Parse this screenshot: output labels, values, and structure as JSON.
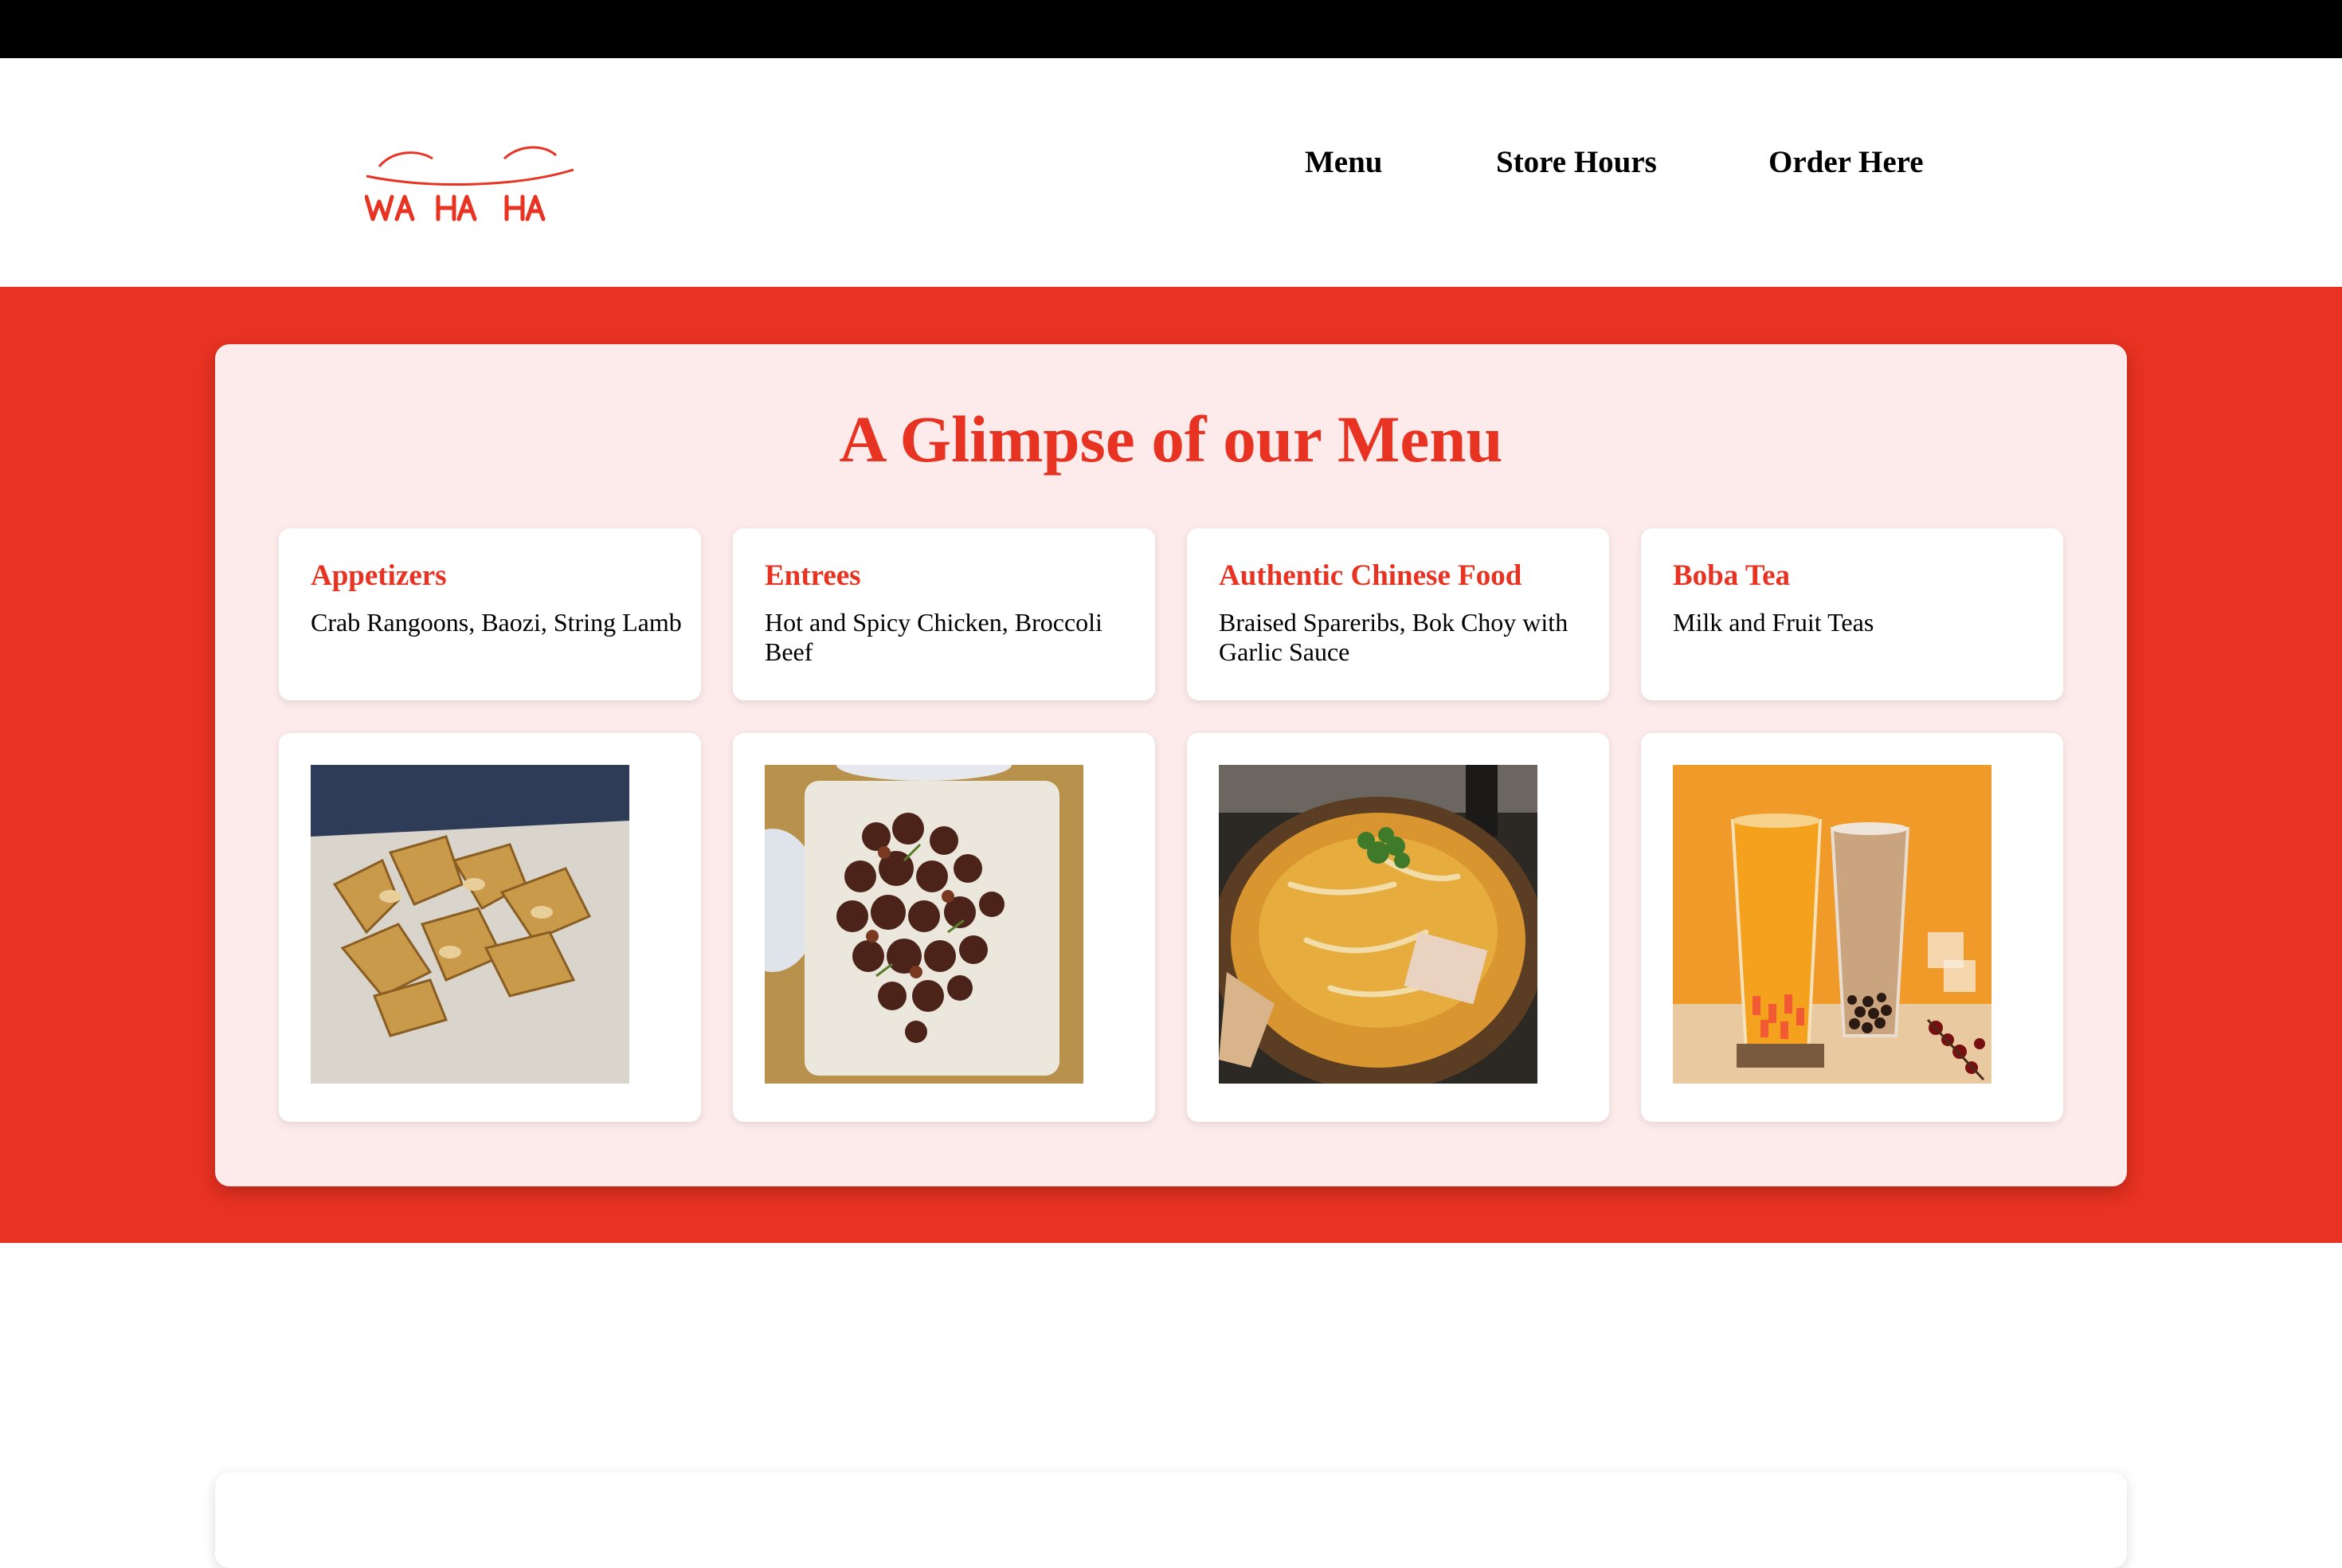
{
  "logo": {
    "text": "WA HA HA",
    "color": "#e83222"
  },
  "nav": {
    "items": [
      {
        "label": "Menu"
      },
      {
        "label": "Store Hours"
      },
      {
        "label": "Order Here"
      }
    ]
  },
  "colors": {
    "accent": "#e83222",
    "panel_background": "#fcebea",
    "card_background": "#ffffff",
    "top_bar": "#000000"
  },
  "menu": {
    "title": "A Glimpse of our Menu",
    "categories": [
      {
        "title": "Appetizers",
        "description": "Crab Rangoons, Baozi, String Lamb",
        "image": "crab-rangoons-photo"
      },
      {
        "title": "Entrees",
        "description": "Hot and Spicy Chicken, Broccoli Beef",
        "image": "spicy-chicken-photo"
      },
      {
        "title": "Authentic Chinese Food",
        "description": "Braised Spareribs, Bok Choy with Garlic Sauce",
        "image": "chinese-soup-photo"
      },
      {
        "title": "Boba Tea",
        "description": "Milk and Fruit Teas",
        "image": "boba-tea-photo"
      }
    ]
  }
}
